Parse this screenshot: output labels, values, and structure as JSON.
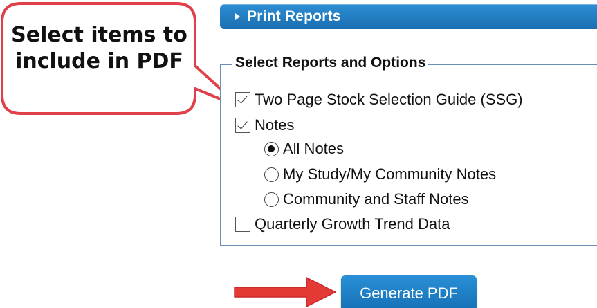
{
  "callout": {
    "text": "Select items to include in PDF"
  },
  "header": {
    "title": "Print Reports"
  },
  "options": {
    "legend": "Select Reports and Options",
    "checkboxes": [
      {
        "label": "Two Page Stock Selection Guide (SSG)",
        "checked": true
      },
      {
        "label": "Notes",
        "checked": true
      },
      {
        "label": "Quarterly Growth Trend Data",
        "checked": false
      }
    ],
    "radios": [
      {
        "label": "All Notes",
        "selected": true
      },
      {
        "label": "My Study/My Community Notes",
        "selected": false
      },
      {
        "label": "Community and Staff Notes",
        "selected": false
      }
    ]
  },
  "button": {
    "label": "Generate PDF"
  },
  "colors": {
    "accent": "#1a7bc4",
    "callout_border": "#e0404a",
    "arrow": "#e53935"
  }
}
